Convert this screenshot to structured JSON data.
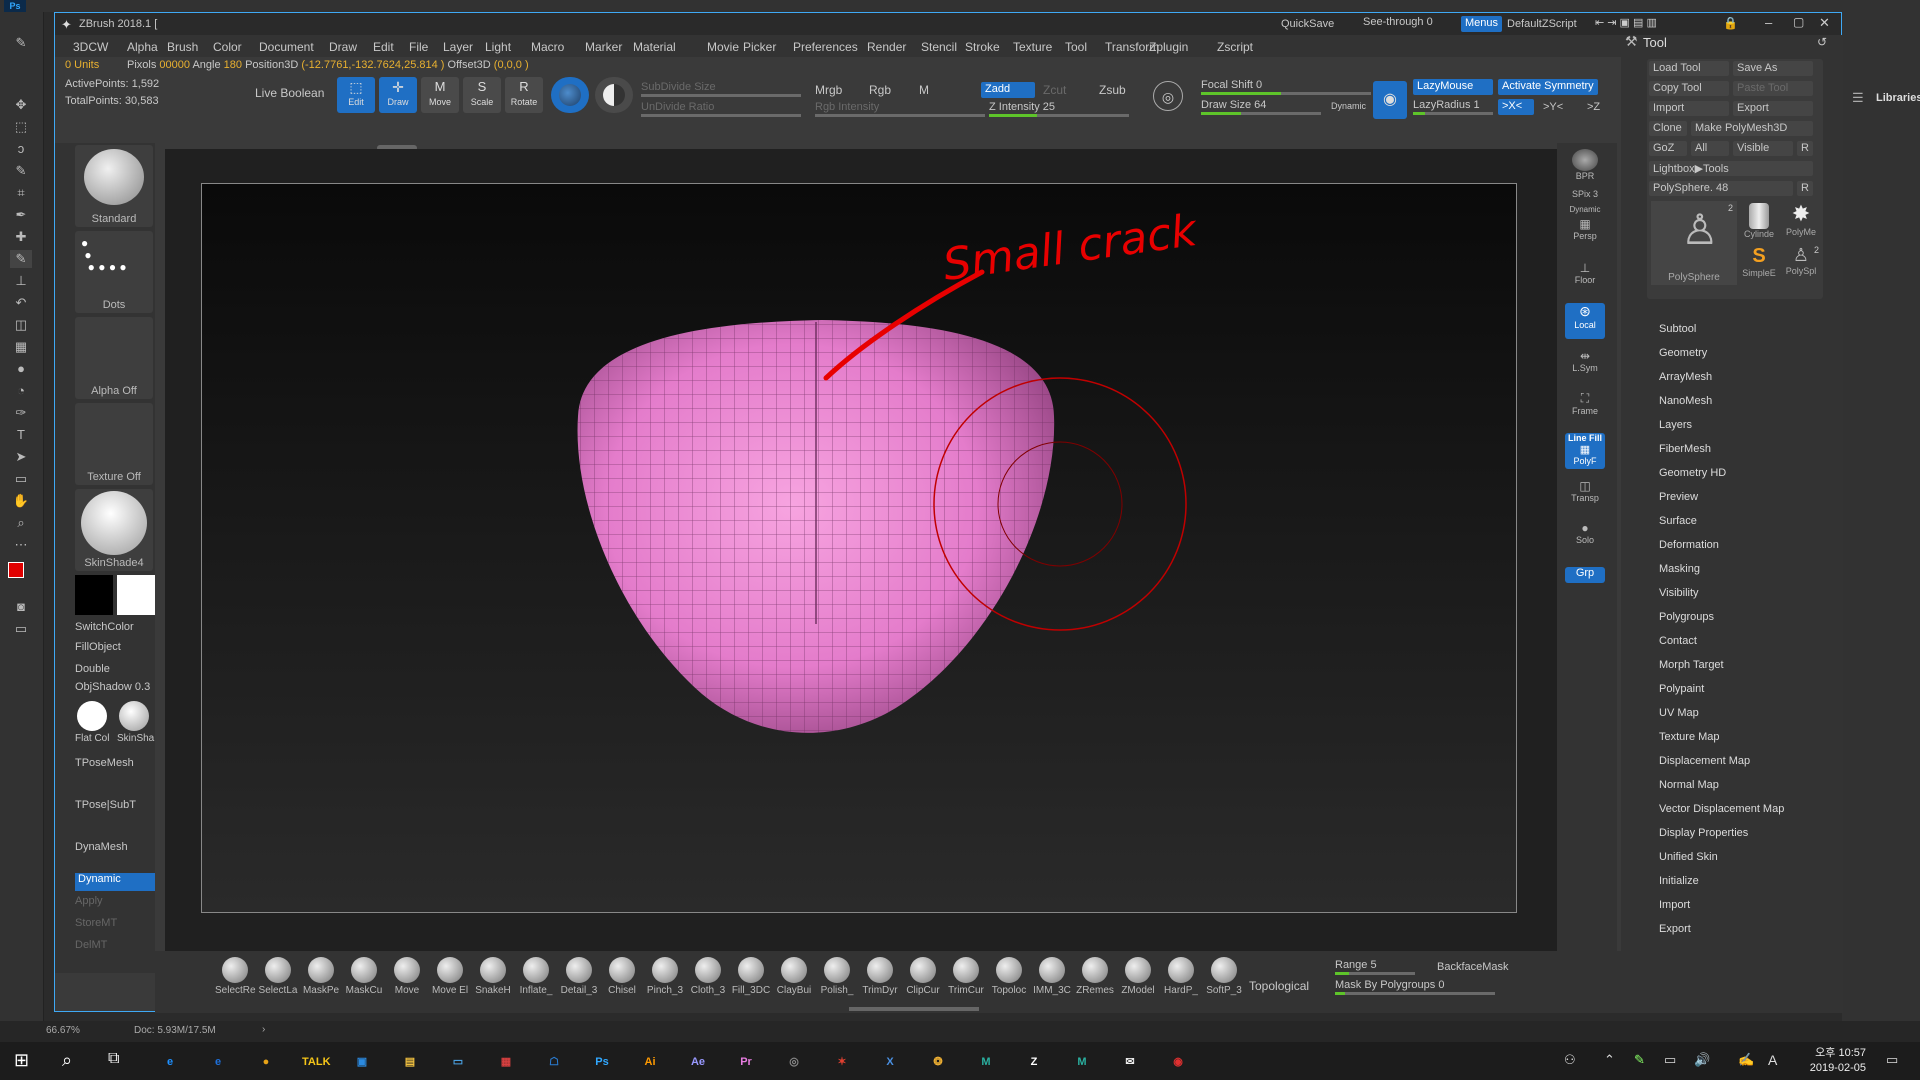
{
  "photoshop": {
    "logo": "Ps",
    "zoom": "66.67%",
    "doc_info": "Doc: 5.93M/17.5M",
    "libraries": "Libraries"
  },
  "zbrush": {
    "title": "ZBrush 2018.1 [",
    "quicksave": "QuickSave",
    "seethrough": "See-through",
    "seethrough_val": "0",
    "menus": "Menus",
    "default_script": "DefaultZScript",
    "menu": [
      "3DCW",
      "Alpha",
      "Brush",
      "Color",
      "Document",
      "Draw",
      "Edit",
      "File",
      "Layer",
      "Light",
      "Macro",
      "Marker",
      "Material",
      "Movie",
      "Picker",
      "Preferences",
      "Render",
      "Stencil",
      "Stroke",
      "Texture",
      "Tool",
      "Transform",
      "Zplugin",
      "Zscript"
    ],
    "info": {
      "units": "0 Units",
      "pixols_label": "Pixols",
      "pixols_val": "00000",
      "angle_label": "Angle",
      "angle_val": "180",
      "position3d_label": "Position3D",
      "position3d_val": "(-12.7761,-132.7624,25.814 )",
      "offset3d_label": "Offset3D",
      "offset3d_val": "(0,0,0 )",
      "active_points": "ActivePoints: 1,592",
      "total_points": "TotalPoints: 30,583"
    },
    "toolbar": {
      "live_boolean": "Live Boolean",
      "edit": "Edit",
      "draw": "Draw",
      "move": "Move",
      "scale": "Scale",
      "rotate": "Rotate",
      "subdivide_size": "SubDivide Size",
      "undivide_ratio": "UnDivide Ratio",
      "mrgb": "Mrgb",
      "rgb": "Rgb",
      "m": "M",
      "rgb_intensity": "Rgb Intensity",
      "zadd": "Zadd",
      "zcut": "Zcut",
      "zsub": "Zsub",
      "z_intensity": "Z Intensity 25",
      "focal_shift": "Focal Shift 0",
      "draw_size": "Draw Size 64",
      "dynamic": "Dynamic",
      "lazymouse": "LazyMouse",
      "lazyradius": "LazyRadius 1",
      "activate_symmetry": "Activate Symmetry",
      "sym_x": ">X<",
      "sym_y": ">Y<",
      "sym_z": ">Z"
    },
    "left_shelf": {
      "brush": "Standard",
      "stroke": "Dots",
      "alpha": "Alpha Off",
      "texture": "Texture Off",
      "material": "SkinShade4",
      "switch_color": "SwitchColor",
      "fill_object": "FillObject",
      "double": "Double",
      "obj_shadow": "ObjShadow 0.3",
      "flat_color": "Flat Col",
      "skinsha": "SkinSha",
      "tpose_mesh": "TPoseMesh",
      "tpose_subt": "TPose|SubT",
      "dynamesh": "DynaMesh",
      "dynamic": "Dynamic",
      "apply": "Apply",
      "store_mt": "StoreMT",
      "del_mt": "DelMT"
    },
    "right_shelf": {
      "bpr": "BPR",
      "spix": "SPix 3",
      "dynamic": "Dynamic",
      "persp": "Persp",
      "floor": "Floor",
      "local": "Local",
      "lsym": "L.Sym",
      "frame": "Frame",
      "polyf": "PolyF",
      "line_fill": "Line Fill",
      "transp": "Transp",
      "solo": "Solo",
      "grp": "Grp"
    },
    "annotation": "Small  crack",
    "bottom": {
      "brushes": [
        "SelectRe",
        "SelectLa",
        "MaskPe",
        "MaskCu",
        "Move",
        "Move El",
        "SnakeH",
        "Inflate_",
        "Detail_3",
        "Chisel",
        "Pinch_3",
        "Cloth_3",
        "Fill_3DC",
        "ClayBui",
        "Polish_",
        "TrimDyr",
        "ClipCur",
        "TrimCur",
        "Topoloc",
        "IMM_3C",
        "ZRemes",
        "ZModel",
        "HardP_",
        "SoftP_3"
      ],
      "topological": "Topological",
      "range": "Range 5",
      "backface_mask": "BackfaceMask",
      "mask_by_polygroups": "Mask By Polygroups 0"
    },
    "tool_panel": {
      "title": "Tool",
      "load_tool": "Load Tool",
      "save_as": "Save As",
      "copy_tool": "Copy Tool",
      "paste_tool": "Paste Tool",
      "import": "Import",
      "export": "Export",
      "clone": "Clone",
      "make_polymesh": "Make PolyMesh3D",
      "goz": "GoZ",
      "all": "All",
      "visible": "Visible",
      "r": "R",
      "lightbox_tools": "Lightbox▶Tools",
      "polysphere": "PolySphere. 48",
      "thumbs": [
        "PolySphere",
        "Cylinde",
        "PolyMe",
        "SimpleE",
        "PolySpl"
      ],
      "thumb_count_1": "2",
      "thumb_count_2": "2",
      "sections": [
        "Subtool",
        "Geometry",
        "ArrayMesh",
        "NanoMesh",
        "Layers",
        "FiberMesh",
        "Geometry HD",
        "Preview",
        "Surface",
        "Deformation",
        "Masking",
        "Visibility",
        "Polygroups",
        "Contact",
        "Morph Target",
        "Polypaint",
        "UV Map",
        "Texture Map",
        "Displacement Map",
        "Normal Map",
        "Vector Displacement Map",
        "Display Properties",
        "Unified Skin",
        "Initialize",
        "Import",
        "Export"
      ]
    }
  },
  "taskbar": {
    "time": "10:57",
    "ampm": "오후",
    "date": "2019-02-05",
    "lang": "A",
    "apps": [
      "e",
      "e",
      "●",
      "TALK",
      "▣",
      "▤",
      "▭",
      "▦",
      "☖",
      "Ps",
      "Ai",
      "Ae",
      "Pr",
      "◎",
      "✶",
      "X",
      "❂",
      "M",
      "Z",
      "M",
      "✉",
      "◉"
    ],
    "app_colors": [
      "#1e90ff",
      "#1e6fd9",
      "#e8a317",
      "#f5c518",
      "#2b8ae0",
      "#f0c040",
      "#4aa0e0",
      "#d84040",
      "#2a7bd0",
      "#31a8ff",
      "#ff9a00",
      "#9999ff",
      "#e77ce0",
      "#888888",
      "#e04030",
      "#4a90e2",
      "#f2b233",
      "#2ab0a0",
      "#ffffff",
      "#2ab0a0",
      "#eeeeee",
      "#e03030"
    ]
  }
}
